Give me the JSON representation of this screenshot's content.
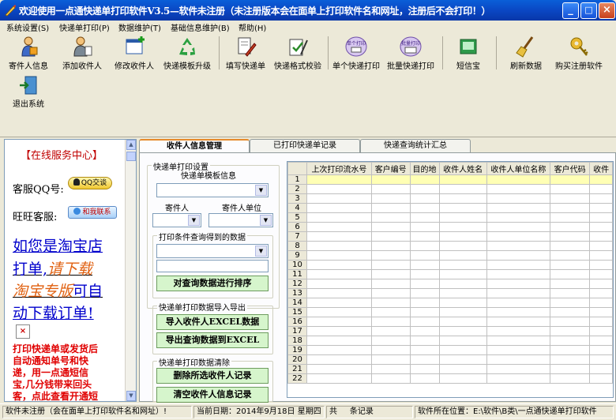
{
  "window": {
    "title": "欢迎使用一点通快递单打印软件V3.5—软件未注册（未注册版本会在面单上打印软件名和网址，注册后不会打印！）",
    "minimize": "_",
    "maximize": "□",
    "close": "×"
  },
  "menu": [
    "系统设置(S)",
    "快递单打印(P)",
    "数据维护(T)",
    "基础信息维护(B)",
    "帮助(H)"
  ],
  "toolbar": {
    "row1": [
      {
        "label": "寄件人信息",
        "icon": "sender-info-icon"
      },
      {
        "label": "添加收件人",
        "icon": "add-recipient-icon"
      },
      {
        "label": "修改收件人",
        "icon": "edit-recipient-icon"
      },
      {
        "label": "快递模板升级",
        "icon": "recycle-template-icon"
      },
      {
        "label": "填写快递单",
        "icon": "fill-waybill-icon"
      },
      {
        "label": "快递格式校验",
        "icon": "format-check-icon"
      },
      {
        "label": "单个快递打印",
        "icon": "single-print-icon",
        "icon_text": "单个打印"
      },
      {
        "label": "批量快递打印",
        "icon": "batch-print-icon",
        "icon_text": "批量打印"
      },
      {
        "label": "短信宝",
        "icon": "sms-icon"
      },
      {
        "label": "刷新数据",
        "icon": "refresh-broom-icon"
      },
      {
        "label": "购买注册软件",
        "icon": "buy-register-key-icon"
      }
    ],
    "row2": [
      {
        "label": "退出系统",
        "icon": "exit-door-icon"
      }
    ]
  },
  "left_panel": {
    "heading": "【在线服务中心】",
    "qq_label": "客服QQ号:",
    "qq_button": "QQ交谈",
    "ww_label": "旺旺客服:",
    "ww_button": "和我联系",
    "promo_line1": "如您是淘宝店",
    "promo_line2a": "打单,",
    "promo_line2b": "请下载",
    "promo_line3a": "淘宝专版",
    "promo_line3b": "可自",
    "promo_line4": "动下载订单!",
    "red_text": [
      "打印快递单或发货后",
      "自动通知单号和快",
      "递，用一点通短信",
      "宝,几分钱带来回头",
      "客，点此查看开通短"
    ]
  },
  "tabs": [
    {
      "label": "收件人信息管理",
      "active": true
    },
    {
      "label": "已打印快递单记录",
      "active": false
    },
    {
      "label": "快递查询统计汇总",
      "active": false
    }
  ],
  "settings": {
    "print_group_title": "快递单打印设置",
    "template_label": "快递单模板信息",
    "sender_label": "寄件人",
    "sender_unit_label": "寄件人单位",
    "query_group_title": "打印条件查询得到的数据",
    "sort_button": "对查询数据进行排序",
    "import_group_title": "快递单打印数据导入导出",
    "import_button": "导入收件人EXCEL数据",
    "export_button": "导出查询数据到EXCEL",
    "clear_group_title": "快递单打印数据清除",
    "delete_button": "删除所选收件人记录",
    "clear_button": "清空收件人信息记录"
  },
  "grid": {
    "columns": [
      "上次打印流水号",
      "客户编号",
      "目的地",
      "收件人姓名",
      "收件人单位名称",
      "客户代码",
      "收件"
    ],
    "rows": [
      "1",
      "2",
      "3",
      "4",
      "5",
      "6",
      "7",
      "8",
      "9",
      "10",
      "11",
      "12",
      "13",
      "14",
      "15",
      "16",
      "17",
      "18",
      "19",
      "20",
      "21",
      "22"
    ]
  },
  "status": {
    "reg": "软件未注册（会在面单上打印软件名和网址）!",
    "date": "当前日期：2014年9月18日 星期四",
    "count_prefix": "共",
    "count_suffix": "条记录",
    "path": "软件所在位置：E:\\软件\\B类\\一点通快递单打印软件"
  }
}
